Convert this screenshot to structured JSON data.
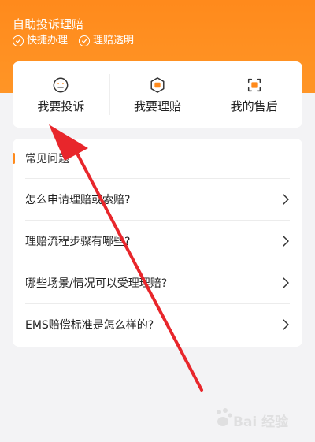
{
  "header": {
    "title": "自助投诉理赔",
    "tags": [
      "快捷办理",
      "理赔透明"
    ]
  },
  "actions": [
    {
      "label": "我要投诉",
      "icon": "complaint-face-icon"
    },
    {
      "label": "我要理赔",
      "icon": "claim-badge-icon"
    },
    {
      "label": "我的售后",
      "icon": "after-sales-icon"
    }
  ],
  "faq": {
    "title": "常见问题",
    "items": [
      "怎么申请理赔或索赔?",
      "理赔流程步骤有哪些?",
      "哪些场景/情况可以受理理赔?",
      "EMS赔偿标准是怎么样的?"
    ]
  },
  "watermark": {
    "text": "Bai 经验"
  },
  "colors": {
    "brand": "#ff8a1c",
    "arrow": "#e8262b"
  }
}
